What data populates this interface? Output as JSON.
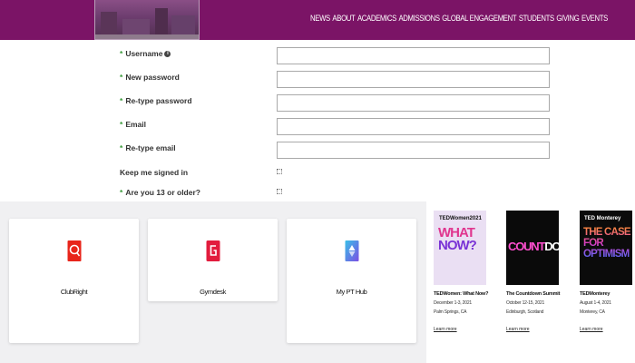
{
  "header": {
    "nav": [
      "NEWS",
      "ABOUT",
      "ACADEMICS",
      "ADMISSIONS",
      "GLOBAL ENGAGEMENT",
      "STUDENTS",
      "GIVING",
      "EVENTS"
    ],
    "bg_color": "#7b1466"
  },
  "form": {
    "username_label": "Username",
    "new_password_label": "New password",
    "retype_password_label": "Re-type password",
    "email_label": "Email",
    "retype_email_label": "Re-type email",
    "keep_signed_label": "Keep me signed in",
    "age_label": "Are you 13 or older?",
    "required_mark": "*",
    "info_icon": "i"
  },
  "apps": [
    {
      "name": "ClubRight",
      "icon": "clubright-icon",
      "color": "#e8251b"
    },
    {
      "name": "Gymdesk",
      "icon": "gymdesk-icon",
      "color": "#e21c3d"
    },
    {
      "name": "My PT Hub",
      "icon": "mypthub-icon",
      "color": "#3b78e7"
    }
  ],
  "events": [
    {
      "title": "TEDWomen: What Now?",
      "date": "December 1-3, 2021",
      "place": "Palm Springs, CA",
      "link": "Learn more",
      "img_brand": "TEDWomen2021",
      "img_text_1": "WHAT",
      "img_text_2": "NOW?"
    },
    {
      "title": "The Countdown Summit",
      "date": "October 12-15, 2021",
      "place": "Edinburgh, Scotland",
      "link": "Learn more",
      "img_text_1": "COUNT",
      "img_text_2": "DOWN"
    },
    {
      "title": "TEDMonterey",
      "date": "August 1-4, 2021",
      "place": "Monterey, CA",
      "link": "Learn more",
      "img_brand": "TED Monterey",
      "img_text_1": "THE CASE FOR",
      "img_text_2": "OPTIMISM"
    }
  ]
}
